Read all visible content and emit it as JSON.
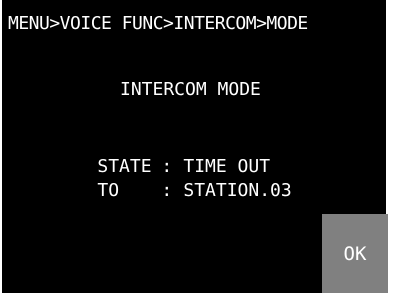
{
  "breadcrumb": "MENU>VOICE FUNC>INTERCOM>MODE",
  "title": "INTERCOM MODE",
  "info": {
    "state": {
      "key": "STATE",
      "sep": ":",
      "value": "TIME OUT"
    },
    "to": {
      "key": "TO",
      "sep": ":",
      "value": "STATION.03"
    }
  },
  "ok_button": {
    "label": "OK"
  },
  "colors": {
    "screen_background": "#000000",
    "text": "#ffffff",
    "button_background": "#808080"
  }
}
